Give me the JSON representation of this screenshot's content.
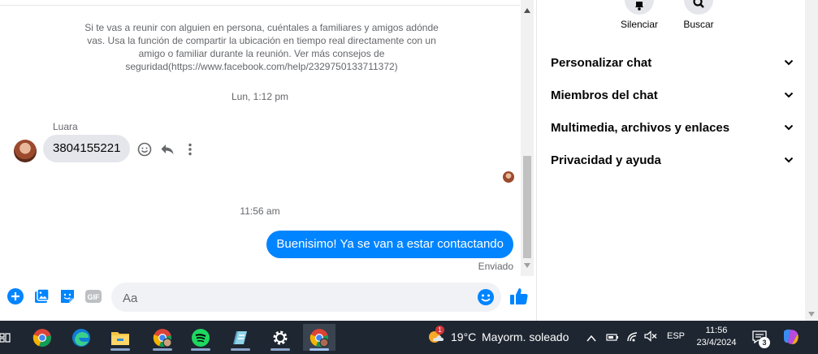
{
  "chat": {
    "safety_notice": "Si te vas a reunir con alguien en persona, cuéntales a familiares y amigos adónde vas. Usa la función de compartir la ubicación en tiempo real directamente con un amigo o familiar durante la reunión. Ver más consejos de seguridad(https://www.facebook.com/help/2329750133711372)",
    "timestamp_1": "Lun, 1:12 pm",
    "sender_name": "Luara",
    "incoming_message": "3804155221",
    "timestamp_2": "11:56 am",
    "outgoing_message": "Buenisimo! Ya se van a estar contactando",
    "sent_status": "Enviado"
  },
  "composer": {
    "placeholder": "Aa",
    "icons": [
      "plus-circle-icon",
      "gallery-icon",
      "sticker-icon",
      "gif-icon",
      "emoji-icon",
      "like-icon"
    ],
    "gif_label": "GIF"
  },
  "details": {
    "mute_label": "Silenciar",
    "search_label": "Buscar",
    "sections": [
      {
        "label": "Personalizar chat"
      },
      {
        "label": "Miembros del chat"
      },
      {
        "label": "Multimedia, archivos y enlaces"
      },
      {
        "label": "Privacidad y ayuda"
      }
    ]
  },
  "taskbar": {
    "weather_temp": "19°C",
    "weather_desc": "Mayorm. soleado",
    "weather_badge": "1",
    "language": "ESP",
    "time": "11:56",
    "date": "23/4/2024",
    "notification_count": "3"
  },
  "colors": {
    "accent": "#0084ff",
    "bubble_in": "#e4e6eb",
    "taskbar": "#1e2631"
  }
}
